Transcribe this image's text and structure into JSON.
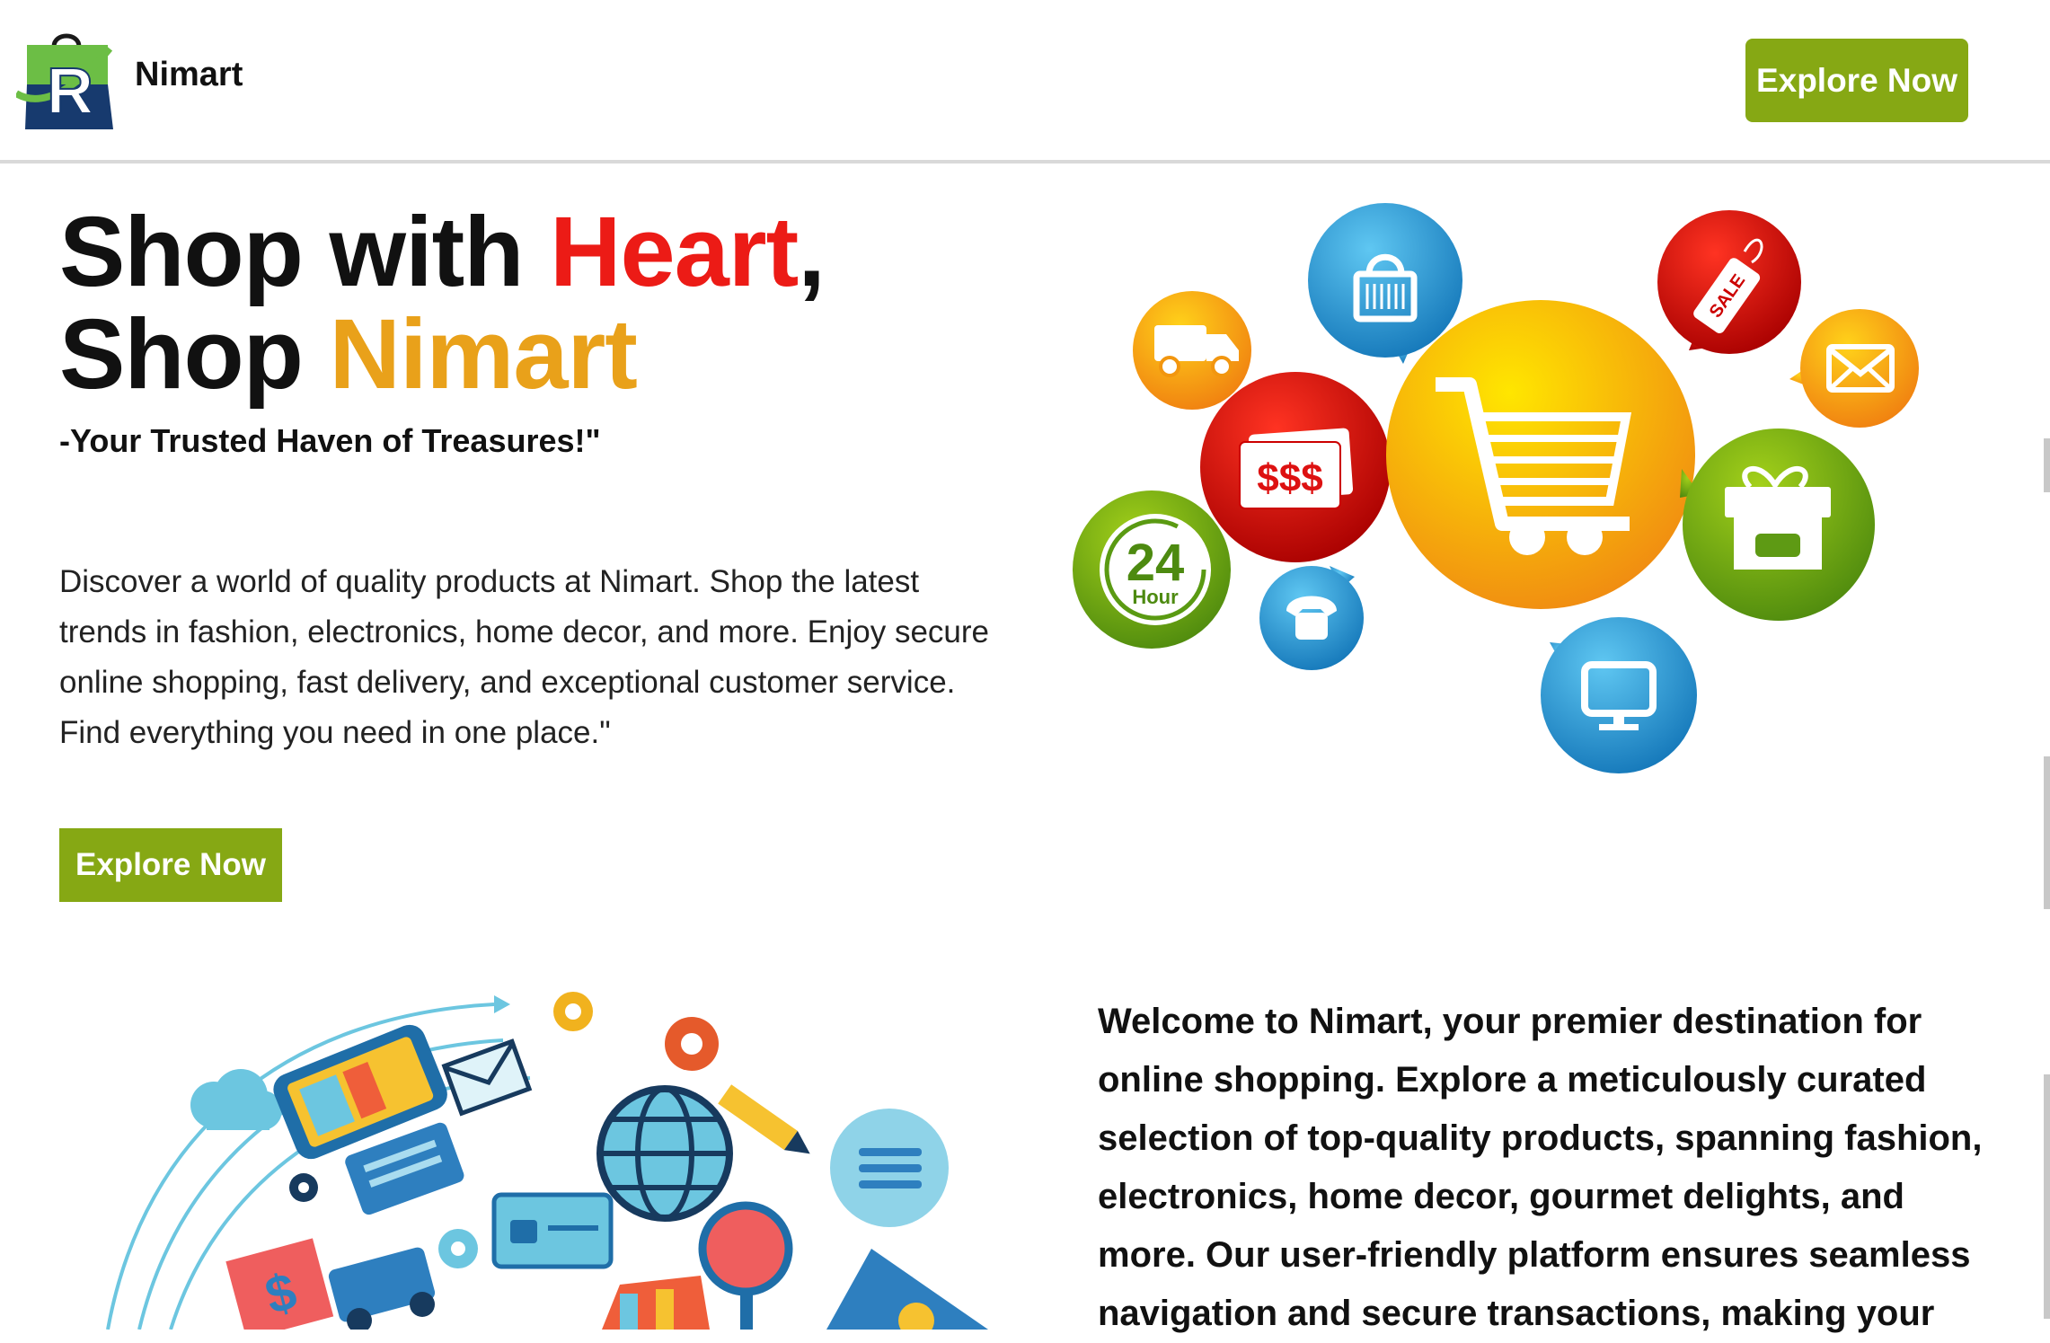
{
  "header": {
    "logo_letter": "R",
    "brand": "Nimart",
    "cta_label": "Explore Now"
  },
  "hero": {
    "title_part1": "Shop with ",
    "title_highlight1": "Heart",
    "title_part2": ",",
    "title_part3": "Shop ",
    "title_highlight2": "Nimart",
    "tagline": "-Your Trusted Haven of Treasures!\"",
    "description": "Discover a world of quality products at Nimart. Shop the latest trends in fashion, electronics, home decor, and more. Enjoy secure online shopping, fast delivery, and exceptional customer service. Find everything you need in one place.\"",
    "cta_label": "Explore Now",
    "art_labels": {
      "money": "$$$",
      "hours": "24",
      "hour_word": "Hour",
      "sale": "SALE"
    }
  },
  "about": {
    "welcome_text": "Welcome to Nimart, your premier destination for online shopping. Explore a meticulously curated selection of top-quality products, spanning fashion, electronics, home decor, gourmet delights, and more. Our user-friendly platform ensures seamless navigation and secure transactions, making your"
  },
  "colors": {
    "accent_green": "#86a814",
    "heart_red": "#ec1b16",
    "nimart_gold": "#e9a11a"
  }
}
